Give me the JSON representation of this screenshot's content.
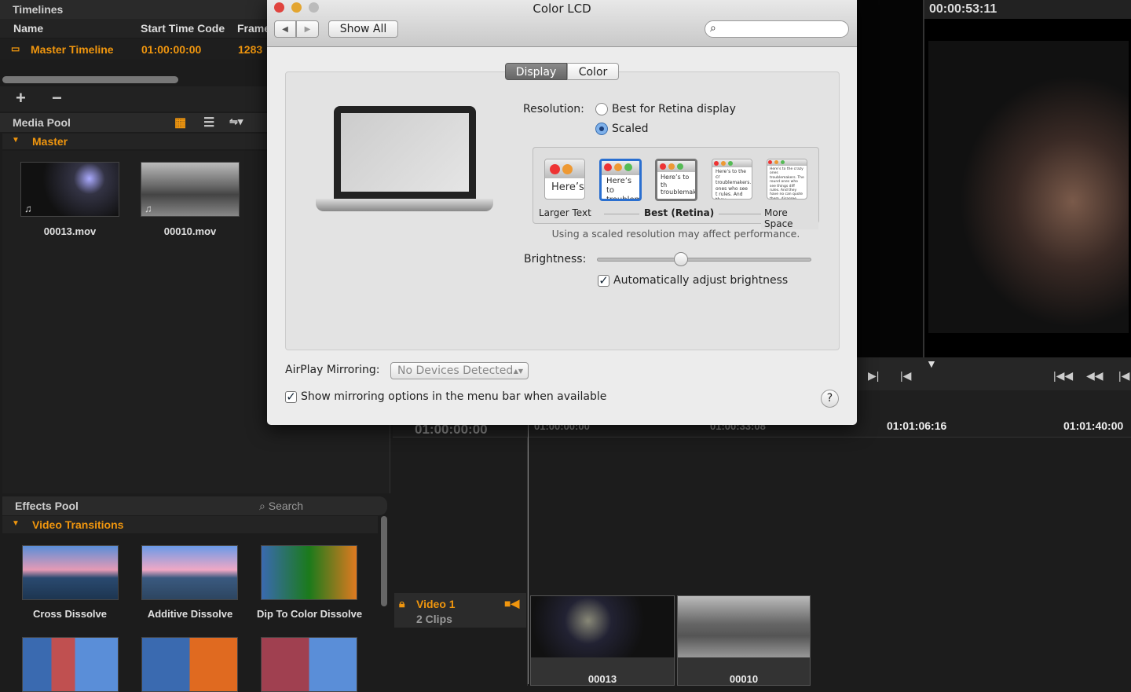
{
  "timelines": {
    "title": "Timelines",
    "columns": [
      "Name",
      "Start Time Code",
      "Frames"
    ],
    "rows": [
      {
        "name": "Master Timeline",
        "start": "01:00:00:00",
        "frames": "1283"
      }
    ],
    "add": "+",
    "remove": "−"
  },
  "media_pool": {
    "title": "Media Pool",
    "folder": "Master",
    "clips": [
      {
        "name": "00013.mov"
      },
      {
        "name": "00010.mov"
      }
    ]
  },
  "effects_pool": {
    "title": "Effects Pool",
    "search_placeholder": "Search",
    "folder": "Video Transitions",
    "items": [
      "Cross Dissolve",
      "Additive Dissolve",
      "Dip To Color Dissolve"
    ]
  },
  "viewer": {
    "timecode": "00:00:53:11"
  },
  "timeline": {
    "ruler": [
      "01:00:00:00",
      "01:00:00:00",
      "01:00:33:08",
      "01:01:06:16",
      "01:01:40:00"
    ],
    "track": {
      "name": "Video 1",
      "clips": "2 Clips"
    },
    "clips": [
      "00013",
      "00010"
    ]
  },
  "dialog": {
    "title": "Color LCD",
    "show_all": "Show All",
    "search_placeholder": "",
    "tabs": [
      "Display",
      "Color"
    ],
    "active_tab": "Display",
    "resolution_label": "Resolution:",
    "options": [
      "Best for Retina display",
      "Scaled"
    ],
    "selected_option": "Scaled",
    "scale_samples": [
      "Here’s",
      "Here’s to troublem",
      "Here’s to th troublemak ones who",
      "Here’s to the cr troublemakers. ones who see t rules. And they",
      "Here’s to the crazy ones troublemakers. The round ones who see things diff rules. And they have no can quote them, disagree them. About the only th Because they change th"
    ],
    "scale_labels": {
      "left": "Larger Text",
      "mid": "Best (Retina)",
      "right": "More Space"
    },
    "note": "Using a scaled resolution may affect performance.",
    "brightness_label": "Brightness:",
    "brightness": 0.39,
    "auto_brightness": "Automatically adjust brightness",
    "auto_brightness_checked": true,
    "airplay_label": "AirPlay Mirroring:",
    "airplay_value": "No Devices Detected",
    "mirroring": "Show mirroring options in the menu bar when available",
    "mirroring_checked": true,
    "help": "?"
  },
  "colors": {
    "accent": "#f0960e",
    "dialog_bg": "#ececec",
    "selection": "#3a7bd5"
  }
}
